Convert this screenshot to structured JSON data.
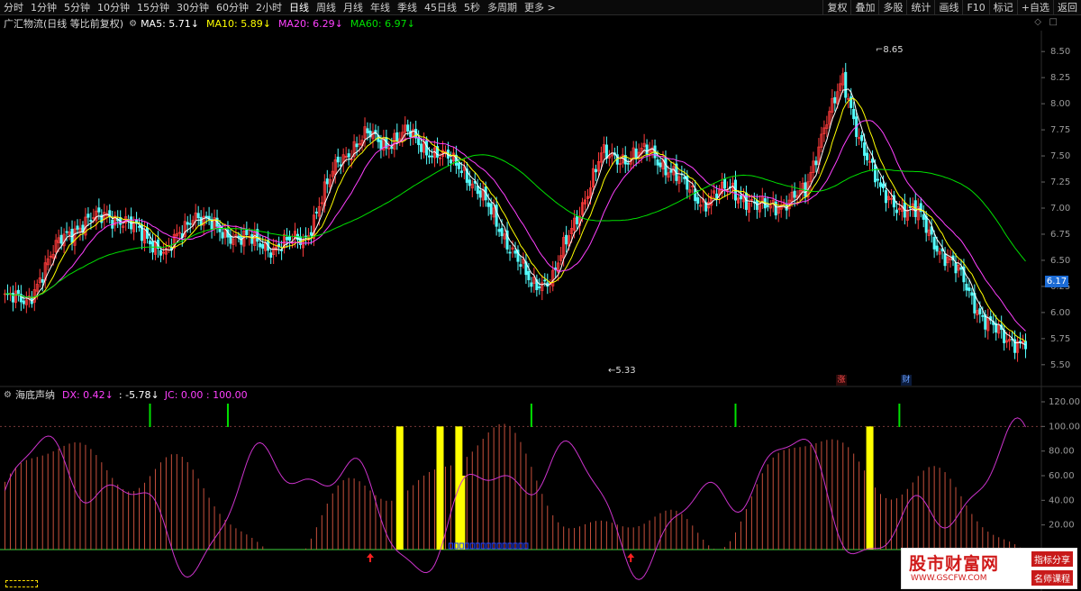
{
  "toolbar": {
    "periods": [
      "分时",
      "1分钟",
      "5分钟",
      "10分钟",
      "15分钟",
      "30分钟",
      "60分钟",
      "2小时",
      "日线",
      "周线",
      "月线",
      "年线",
      "季线",
      "45日线",
      "5秒",
      "多周期"
    ],
    "active_period": "日线",
    "more_label": "更多 >",
    "tools": [
      "复权",
      "叠加",
      "多股",
      "统计",
      "画线",
      "F10",
      "标记",
      "+自选",
      "返回"
    ]
  },
  "main_chart": {
    "stock_title": "广汇物流(日线 等比前复权)",
    "ma": [
      {
        "label": "MA5: 5.71↓",
        "color": "#ffffff"
      },
      {
        "label": "MA10: 5.89↓",
        "color": "#ffff00"
      },
      {
        "label": "MA20: 6.29↓",
        "color": "#ff40ff"
      },
      {
        "label": "MA60: 6.97↓",
        "color": "#00e000"
      }
    ],
    "y_ticks": [
      "8.50",
      "8.25",
      "8.00",
      "7.75",
      "7.50",
      "7.25",
      "7.00",
      "6.75",
      "6.50",
      "6.25",
      "6.00",
      "5.75",
      "5.50"
    ],
    "current_price": "6.17",
    "max_label": "8.65",
    "min_label": "5.33",
    "badge_up": "涨",
    "badge_fin": "财"
  },
  "sub_chart": {
    "title": "海底声纳",
    "dx": "DX: 0.42↓",
    "dx_color": "#ff40ff",
    "extra": ": -5.78↓",
    "jc": "JC: 0.00 : 100.00",
    "y_ticks": [
      "120.00",
      "100.00",
      "80.00",
      "60.00",
      "40.00",
      "20.00"
    ]
  },
  "watermark": {
    "main": "股市财富网",
    "url": "WWW.GSCFW.COM",
    "tag1": "指标分享",
    "tag2": "名师课程"
  },
  "colors": {
    "up": "#ff3b3b",
    "down": "#54ffff",
    "ma5": "#ffffff",
    "ma10": "#ffff00",
    "ma20": "#ff40ff",
    "ma60": "#00e000",
    "bar": "#c8503c",
    "signal": "#ffff00"
  }
}
